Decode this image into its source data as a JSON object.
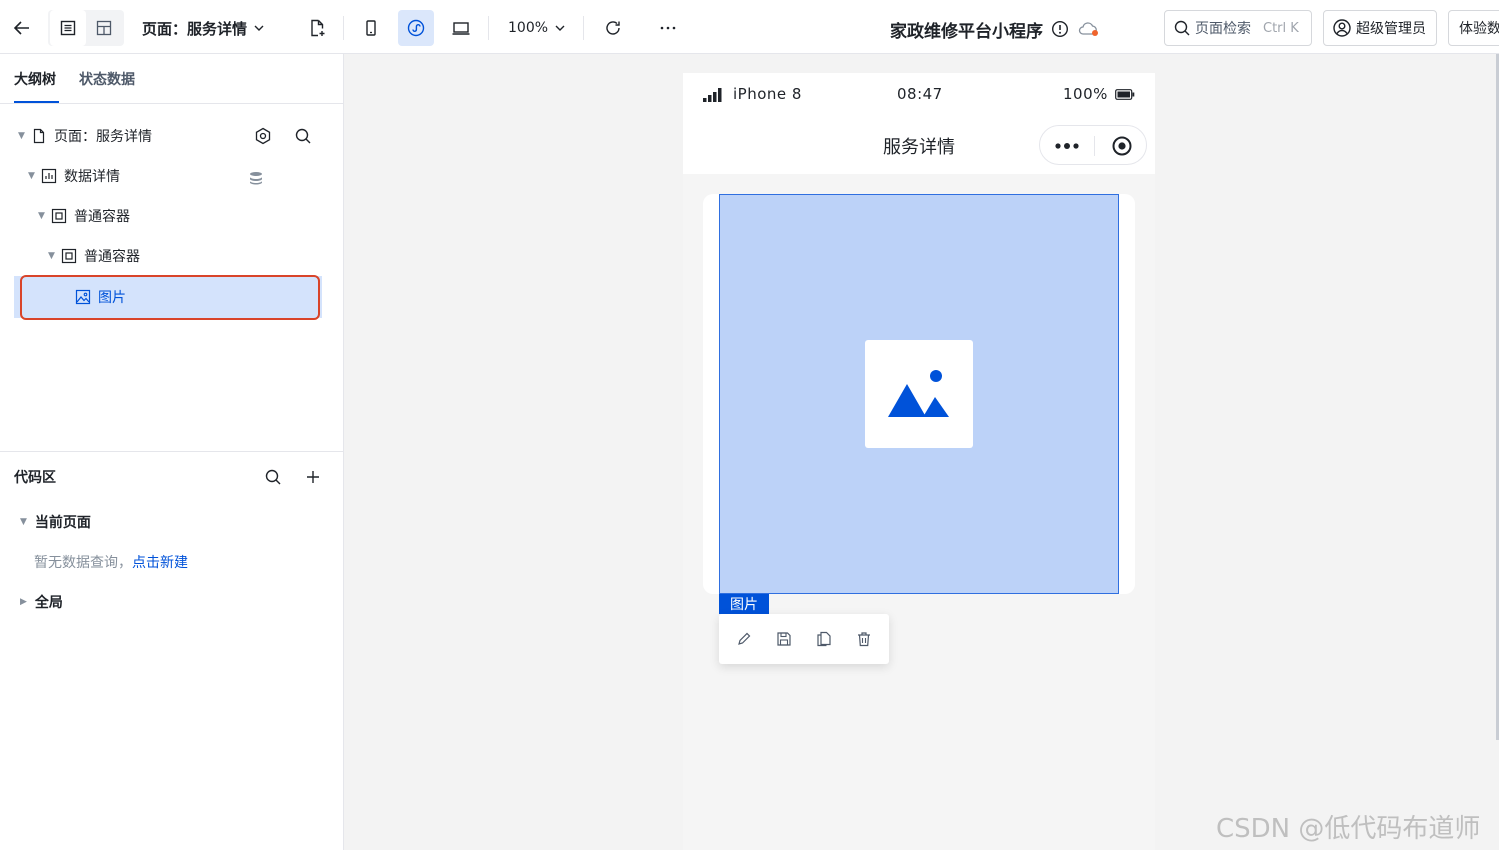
{
  "toolbar": {
    "page_select_label": "页面：服务详情",
    "zoom_label": "100%",
    "app_title": "家政维修平台小程序",
    "search_label": "页面检索",
    "search_shortcut": "Ctrl K",
    "admin_label": "超级管理员",
    "trial_label": "体验数"
  },
  "left_panel": {
    "tabs": [
      {
        "label": "大纲树"
      },
      {
        "label": "状态数据"
      }
    ],
    "tree": {
      "page": "页面：服务详情",
      "data_detail": "数据详情",
      "container_1": "普通容器",
      "container_2": "普通容器",
      "image": "图片"
    },
    "code_area": {
      "title": "代码区",
      "current_page": "当前页面",
      "empty_hint": "暂无数据查询，",
      "create_link": "点击新建",
      "global": "全局"
    }
  },
  "phone": {
    "device_name": "iPhone 8",
    "time": "08:47",
    "battery": "100%",
    "nav_title": "服务详情",
    "selected_tag": "图片"
  },
  "watermark": "CSDN @低代码布道师",
  "colors": {
    "accent": "#0052d9",
    "selection_fill": "#bcd2f8",
    "highlight_border": "#d9442a"
  }
}
